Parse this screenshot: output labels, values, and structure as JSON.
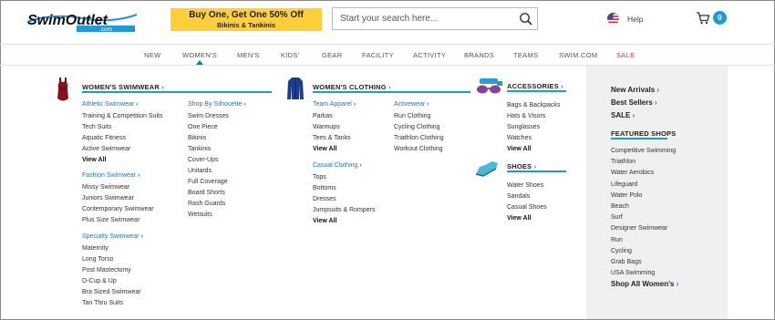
{
  "header": {
    "logo": {
      "main": "SwimOutlet",
      "sub": ".com"
    },
    "promo": {
      "line1": "Buy One, Get One 50% Off",
      "line2": "Bikinis & Tankinis"
    },
    "search": {
      "placeholder": "Start your search here..."
    },
    "help_label": "Help",
    "cart_count": "0"
  },
  "nav": {
    "items": [
      "NEW",
      "WOMEN'S",
      "MEN'S",
      "KIDS'",
      "GEAR",
      "FACILITY",
      "ACTIVITY",
      "BRANDS",
      "TEAMS",
      "SWIM.COM",
      "SALE"
    ],
    "active": "WOMEN'S",
    "sale_color": "#d63b2a"
  },
  "menu": {
    "swimwear": {
      "title": "WOMEN'S SWIMWEAR",
      "athletic": {
        "title": "Athletic Swimwear",
        "items": [
          "Training & Competition Suits",
          "Tech Suits",
          "Aquatic Fitness",
          "Active Swimwear"
        ],
        "view_all": "View All"
      },
      "fashion": {
        "title": "Fashion Swimwear",
        "items": [
          "Missy Swimwear",
          "Juniors Swimwear",
          "Contemporary Swimwear",
          "Plus Size Swimwear"
        ]
      },
      "specialty": {
        "title": "Specialty Swimwear",
        "items": [
          "Maternity",
          "Long Torso",
          "Post Mastectomy",
          "D-Cup & Up",
          "Bra Sized Swimwear",
          "Tan Thru Suits"
        ]
      },
      "silhouette": {
        "title": "Shop By Silhouette",
        "items": [
          "Swim Dresses",
          "One Piece",
          "Bikinis",
          "Tankinis",
          "Cover-Ups",
          "Unitards",
          "Full Coverage",
          "Board Shorts",
          "Rash Guards",
          "Wetsuits"
        ]
      }
    },
    "clothing": {
      "title": "WOMEN'S CLOTHING",
      "team": {
        "title": "Team Apparel",
        "items": [
          "Parkas",
          "Warmups",
          "Tees & Tanks"
        ],
        "view_all": "View All"
      },
      "casual": {
        "title": "Casual Clothing",
        "items": [
          "Tops",
          "Bottoms",
          "Dresses",
          "Jumpsuits & Rompers"
        ],
        "view_all": "View All"
      },
      "active": {
        "title": "Activewear",
        "items": [
          "Run Clothing",
          "Cycling Clothing",
          "Triathlon Clothing",
          "Workout Clothing"
        ]
      }
    },
    "accessories": {
      "title": "ACCESSORIES",
      "items": [
        "Bags & Backpacks",
        "Hats & Visors",
        "Sunglasses",
        "Watches"
      ],
      "view_all": "View All"
    },
    "shoes": {
      "title": "SHOES",
      "items": [
        "Water Shoes",
        "Sandals",
        "Casual Shoes"
      ],
      "view_all": "View All"
    },
    "right": {
      "links": [
        "New Arrivals",
        "Best Sellers",
        "SALE"
      ],
      "featured_title": "FEATURED SHOPS",
      "featured": [
        "Competitive Swimming",
        "Triathlon",
        "Water Aerobics",
        "Lifeguard",
        "Water Polo",
        "Beach",
        "Surf",
        "Designer Swimwear",
        "Run",
        "Cycling",
        "Grab Bags",
        "USA Swimming"
      ],
      "shop_all": "Shop All Women's"
    }
  },
  "colors": {
    "accent": "#1e9ad6",
    "link": "#1e77b5",
    "promo": "#ffcf3a"
  },
  "icons": [
    "search-icon",
    "us-flag-icon",
    "cart-icon",
    "chevron-right-icon"
  ]
}
